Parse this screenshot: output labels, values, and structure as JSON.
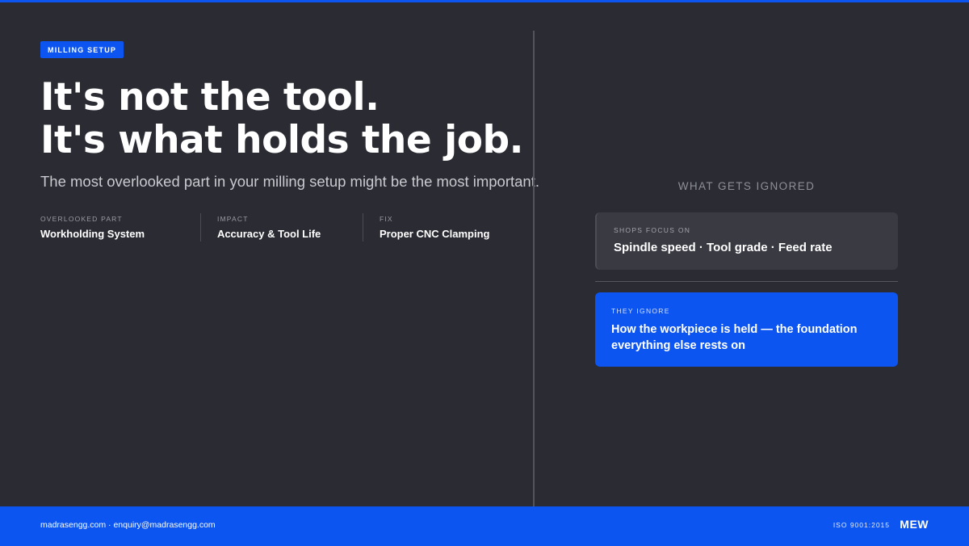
{
  "tag": "MILLING SETUP",
  "headline": {
    "line1": "It's not the tool.",
    "line2": "It's what holds the job."
  },
  "subtitle": "The most overlooked part in your milling setup might be the most important.",
  "facts": [
    {
      "label": "OVERLOOKED PART",
      "value": "Workholding System"
    },
    {
      "label": "IMPACT",
      "value": "Accuracy & Tool Life"
    },
    {
      "label": "FIX",
      "value": "Proper CNC Clamping"
    }
  ],
  "section_heading": "WHAT GETS IGNORED",
  "focus_card": {
    "label": "SHOPS FOCUS ON",
    "text": "Spindle speed · Tool grade · Feed rate"
  },
  "ignore_card": {
    "label": "THEY IGNORE",
    "text": "How the workpiece is held — the foundation everything else rests on"
  },
  "footer": {
    "contact": "madrasengg.com · enquiry@madrasengg.com",
    "certification": "ISO 9001:2015",
    "logo": "MEW"
  },
  "colors": {
    "background": "#2b2c33",
    "accent": "#0d55f0",
    "card": "#393a42"
  }
}
